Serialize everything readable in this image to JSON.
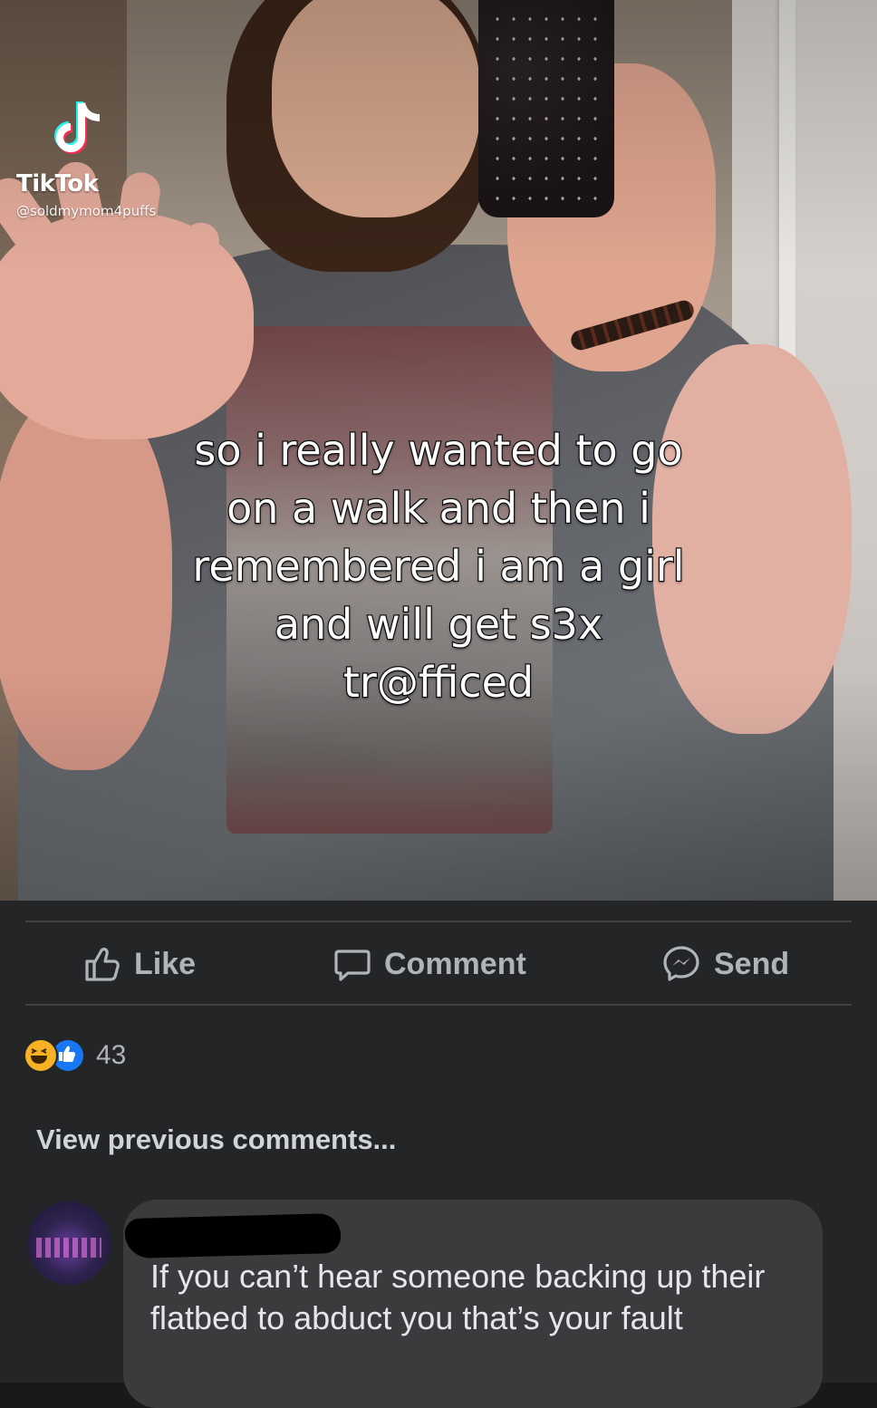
{
  "video": {
    "watermark": {
      "icon": "tiktok-logo-icon",
      "brand": "TikTok",
      "handle": "@soldmymom4puffs"
    },
    "caption_lines": [
      "so i really wanted to go",
      "on a walk and then i",
      "remembered i am a girl",
      "and will get s3x",
      "tr@fficed"
    ]
  },
  "actions": {
    "like": {
      "label": "Like",
      "icon": "thumbs-up-icon"
    },
    "comment": {
      "label": "Comment",
      "icon": "comment-bubble-icon"
    },
    "send": {
      "label": "Send",
      "icon": "messenger-icon"
    }
  },
  "reactions": {
    "icons": [
      "haha-reaction-icon",
      "like-reaction-icon"
    ],
    "count": "43"
  },
  "comments": {
    "view_previous": "View previous comments...",
    "items": [
      {
        "author_redacted": true,
        "text": "If you can’t hear someone backing up their flatbed to abduct you that’s your fault"
      }
    ]
  },
  "colors": {
    "background": "#242526",
    "bubble": "#3a3b3c",
    "action_text": "#b0b3b8",
    "haha": "#f7b125",
    "like": "#1877f2"
  }
}
